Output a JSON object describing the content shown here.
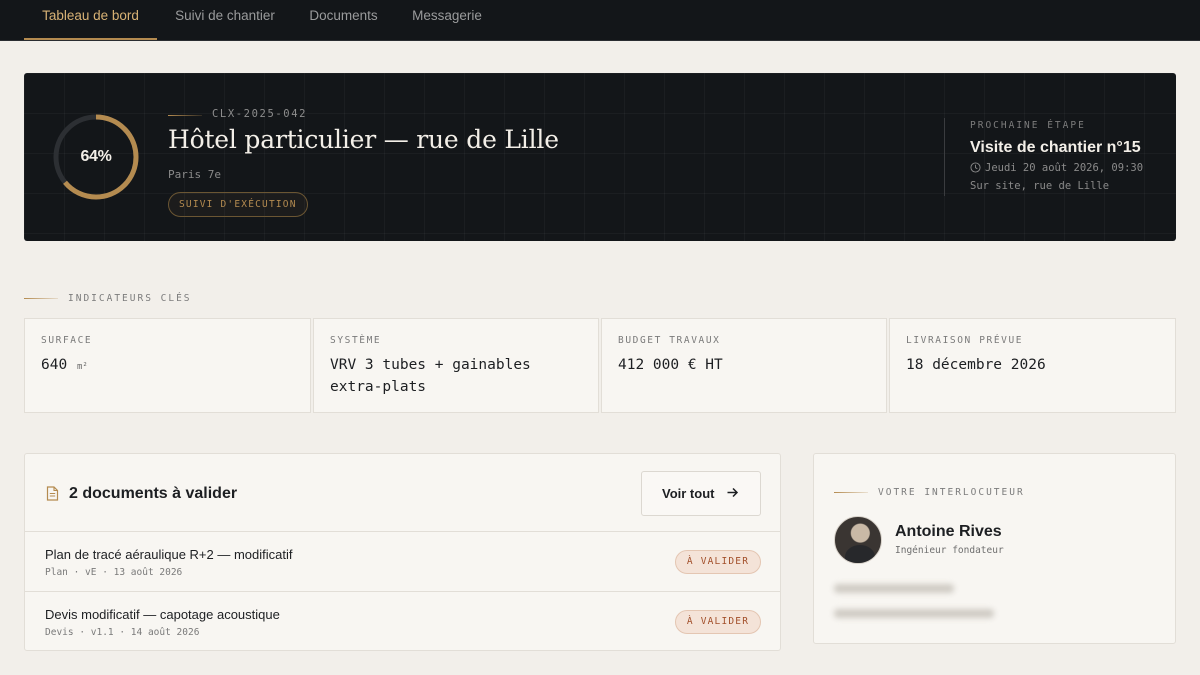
{
  "nav": {
    "tabs": [
      {
        "label": "Tableau de bord",
        "active": true
      },
      {
        "label": "Suivi de chantier",
        "active": false
      },
      {
        "label": "Documents",
        "active": false
      },
      {
        "label": "Messagerie",
        "active": false
      }
    ]
  },
  "hero": {
    "progress_percent": 64,
    "progress_label": "64%",
    "project_code": "CLX-2025-042",
    "project_title": "Hôtel particulier — rue de Lille",
    "location": "Paris 7e",
    "status": "SUIVI D'EXÉCUTION",
    "next_step": {
      "kicker": "PROCHAINE ÉTAPE",
      "title": "Visite de chantier n°15",
      "date": "Jeudi 20 août 2026, 09:30",
      "place": "Sur site, rue de Lille",
      "icon": "clock-icon"
    }
  },
  "indicators": {
    "kicker": "INDICATEURS CLÉS",
    "items": [
      {
        "label": "SURFACE",
        "value": "640",
        "unit": "m²"
      },
      {
        "label": "SYSTÈME",
        "value": "VRV 3 tubes + gainables extra-plats",
        "unit": ""
      },
      {
        "label": "BUDGET TRAVAUX",
        "value": "412 000 € HT",
        "unit": ""
      },
      {
        "label": "LIVRAISON PRÉVUE",
        "value": "18 décembre 2026",
        "unit": ""
      }
    ]
  },
  "documents": {
    "title": "2 documents à valider",
    "icon": "document-icon",
    "see_all_label": "Voir tout",
    "rows": [
      {
        "name": "Plan de tracé aéraulique R+2 — modificatif",
        "meta": "Plan · vE · 13 août 2026",
        "badge": "À VALIDER"
      },
      {
        "name": "Devis modificatif — capotage acoustique",
        "meta": "Devis · v1.1 · 14 août 2026",
        "badge": "À VALIDER"
      }
    ]
  },
  "contact": {
    "kicker": "VOTRE INTERLOCUTEUR",
    "name": "Antoine Rives",
    "role": "Ingénieur fondateur"
  },
  "colors": {
    "accent": "#b48b50",
    "dark_bg": "#131619",
    "page_bg": "#f2efea",
    "badge_text": "#a24f2a"
  }
}
